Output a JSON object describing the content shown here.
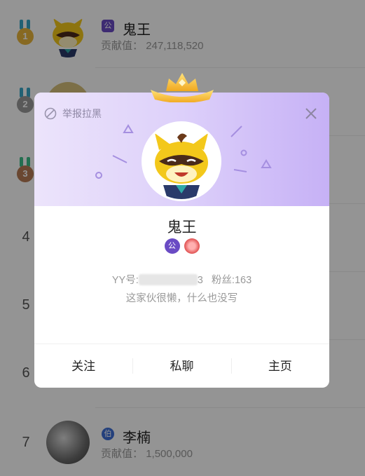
{
  "ranking": {
    "rows": [
      {
        "rank": "1",
        "name": "鬼王",
        "badge": "公",
        "contribution_label": "贡献值：",
        "contribution": "247,118,520"
      },
      {
        "rank": "2",
        "name": "",
        "badge": "",
        "contribution_label": "",
        "contribution": ""
      },
      {
        "rank": "3",
        "name": "",
        "badge": "",
        "contribution_label": "",
        "contribution": ""
      },
      {
        "rank": "4",
        "name": "",
        "badge": "",
        "contribution_label": "",
        "contribution": ""
      },
      {
        "rank": "5",
        "name": "",
        "badge": "",
        "contribution_label": "",
        "contribution": ""
      },
      {
        "rank": "6",
        "name": "",
        "badge": "",
        "contribution_label": "",
        "contribution": ""
      },
      {
        "rank": "7",
        "name": "李楠",
        "badge": "伯",
        "contribution_label": "贡献值：",
        "contribution": "1,500,000"
      }
    ]
  },
  "profile_card": {
    "report_label": "举报拉黑",
    "name": "鬼王",
    "badge_text": "公",
    "yy_label": "YY号:",
    "yy_suffix": "3",
    "fans_label": "粉丝:",
    "fans_count": "163",
    "signature": "这家伙很懒，什么也没写",
    "actions": {
      "follow": "关注",
      "chat": "私聊",
      "home": "主页"
    }
  },
  "colors": {
    "header_gradient_start": "#ece4fb",
    "header_gradient_end": "#c6b1f6",
    "gold": "#e8b53c",
    "silver": "#9a9a9a",
    "bronze": "#b77a55",
    "badge_purple": "#6a4bc4"
  },
  "icons": [
    "report-icon",
    "close-icon",
    "crown-icon",
    "gold-medal-icon",
    "silver-medal-icon",
    "bronze-medal-icon"
  ]
}
